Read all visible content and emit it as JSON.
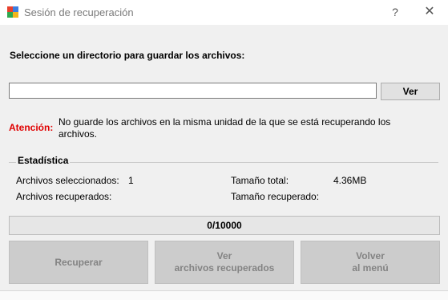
{
  "window": {
    "title": "Sesión de recuperación",
    "help_glyph": "?",
    "close_glyph": "✕"
  },
  "directory": {
    "prompt": "Seleccione un directorio para guardar los archivos:",
    "value": "",
    "browse_label": "Ver"
  },
  "warning": {
    "label": "Atención:",
    "text": "No guarde los archivos en la misma unidad de la que se está recuperando los archivos."
  },
  "stats": {
    "title": "Estadística",
    "selected_label": "Archivos seleccionados:",
    "selected_value": "1",
    "recovered_label": "Archivos recuperados:",
    "recovered_value": "",
    "total_size_label": "Tamaño total:",
    "total_size_value": "4.36MB",
    "recovered_size_label": "Tamaño recuperado:",
    "recovered_size_value": ""
  },
  "progress": {
    "text": "0/10000",
    "fraction": 0
  },
  "actions": {
    "recover": {
      "line1": "Recuperar",
      "line2": ""
    },
    "view": {
      "line1": "Ver",
      "line2": "archivos recuperados"
    },
    "back": {
      "line1": "Volver",
      "line2": "al menú"
    }
  },
  "icons": {
    "app": "app-logo-icon",
    "help": "help-icon",
    "close": "close-icon"
  },
  "colors": {
    "warning": "#e00000",
    "disabled_button_bg": "#cccccc",
    "disabled_button_text": "#838383"
  }
}
